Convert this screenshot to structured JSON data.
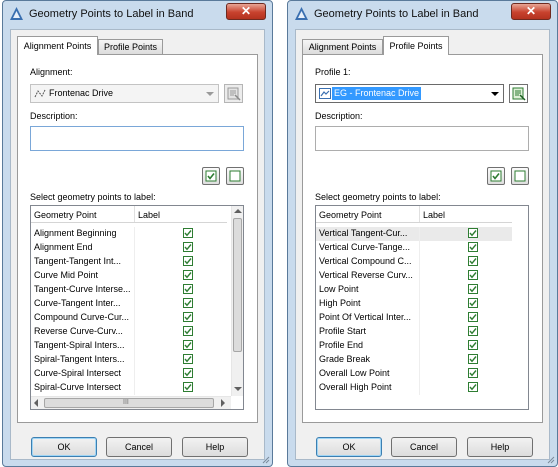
{
  "colors": {
    "check": "#2e7d32",
    "selection": "#3399ff",
    "close_button": "#c8422e"
  },
  "dialogs": [
    {
      "title": "Geometry Points to Label in Band",
      "close_glyph": "✕",
      "tabs": [
        {
          "label": "Alignment Points"
        },
        {
          "label": "Profile Points"
        }
      ],
      "active_tab": 0,
      "selector_label": "Alignment:",
      "selector_value": "Frontenac Drive",
      "selector_icon": "alignment-icon",
      "description_label": "Description:",
      "description_value": "",
      "select_label": "Select geometry points to label:",
      "columns": [
        "Geometry Point",
        "Label"
      ],
      "rows": [
        {
          "name": "Alignment Beginning",
          "checked": true
        },
        {
          "name": "Alignment End",
          "checked": true
        },
        {
          "name": "Tangent-Tangent Int...",
          "checked": true
        },
        {
          "name": "Curve Mid Point",
          "checked": true
        },
        {
          "name": "Tangent-Curve Interse...",
          "checked": true
        },
        {
          "name": "Curve-Tangent Inter...",
          "checked": true
        },
        {
          "name": "Compound Curve-Cur...",
          "checked": true
        },
        {
          "name": "Reverse Curve-Curv...",
          "checked": true
        },
        {
          "name": "Tangent-Spiral Inters...",
          "checked": true
        },
        {
          "name": "Spiral-Tangent Inters...",
          "checked": true
        },
        {
          "name": "Curve-Spiral Intersect",
          "checked": true
        },
        {
          "name": "Spiral-Curve Intersect",
          "checked": true
        }
      ],
      "hscroll_grip": "III",
      "buttons": {
        "ok": "OK",
        "cancel": "Cancel",
        "help": "Help"
      }
    },
    {
      "title": "Geometry Points to Label in Band",
      "close_glyph": "✕",
      "tabs": [
        {
          "label": "Alignment Points"
        },
        {
          "label": "Profile Points"
        }
      ],
      "active_tab": 1,
      "selector_label": "Profile 1:",
      "selector_value": "EG - Frontenac Drive",
      "selector_icon": "profile-icon",
      "description_label": "Description:",
      "description_value": "",
      "select_label": "Select geometry points to label:",
      "columns": [
        "Geometry Point",
        "Label"
      ],
      "rows": [
        {
          "name": "Vertical Tangent-Cur...",
          "checked": true
        },
        {
          "name": "Vertical Curve-Tange...",
          "checked": true
        },
        {
          "name": "Vertical Compound C...",
          "checked": true
        },
        {
          "name": "Vertical Reverse Curv...",
          "checked": true
        },
        {
          "name": "Low Point",
          "checked": true
        },
        {
          "name": "High Point",
          "checked": true
        },
        {
          "name": "Point Of Vertical Inter...",
          "checked": true
        },
        {
          "name": "Profile Start",
          "checked": true
        },
        {
          "name": "Profile End",
          "checked": true
        },
        {
          "name": "Grade Break",
          "checked": true
        },
        {
          "name": "Overall Low Point",
          "checked": true
        },
        {
          "name": "Overall High Point",
          "checked": true
        }
      ],
      "buttons": {
        "ok": "OK",
        "cancel": "Cancel",
        "help": "Help"
      }
    }
  ]
}
